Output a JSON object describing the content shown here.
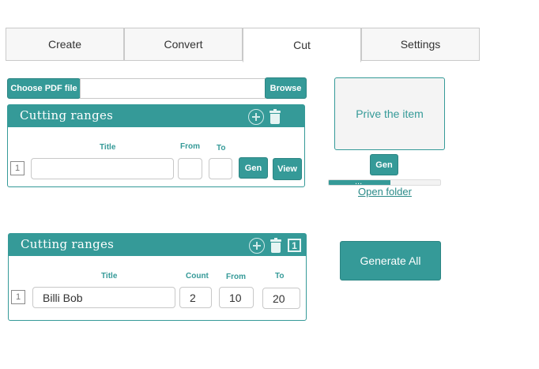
{
  "tabs": [
    {
      "label": "Create"
    },
    {
      "label": "Convert"
    },
    {
      "label": "Cut"
    },
    {
      "label": "Settings"
    }
  ],
  "file_picker": {
    "choose_label": "Choose PDF file",
    "path_value": "",
    "browse_label": "Browse"
  },
  "ranges_panel_1": {
    "title": "Cutting ranges",
    "columns": {
      "title": "Title",
      "from": "From",
      "to": "To"
    },
    "row": {
      "number": "1",
      "title": "",
      "from": "",
      "to": ""
    },
    "gen_label": "Gen",
    "view_label": "View"
  },
  "preview": {
    "text": "Prive the item",
    "gen_label": "Gen",
    "progress": {
      "fraction": 0.55,
      "text": "..."
    },
    "open_folder_label": "Open folder"
  },
  "ranges_panel_2": {
    "title": "Cutting ranges",
    "header_badge": "1",
    "columns": {
      "title": "Title",
      "count": "Count",
      "from": "From",
      "to": "To"
    },
    "row": {
      "number": "1",
      "title": "Billi Bob",
      "count": "2",
      "from": "10",
      "to": "20"
    }
  },
  "generate_all_label": "Generate All",
  "colors": {
    "accent": "#359a98",
    "tab_border": "#c9c9c9",
    "preview_bg": "#f4f4f4"
  }
}
